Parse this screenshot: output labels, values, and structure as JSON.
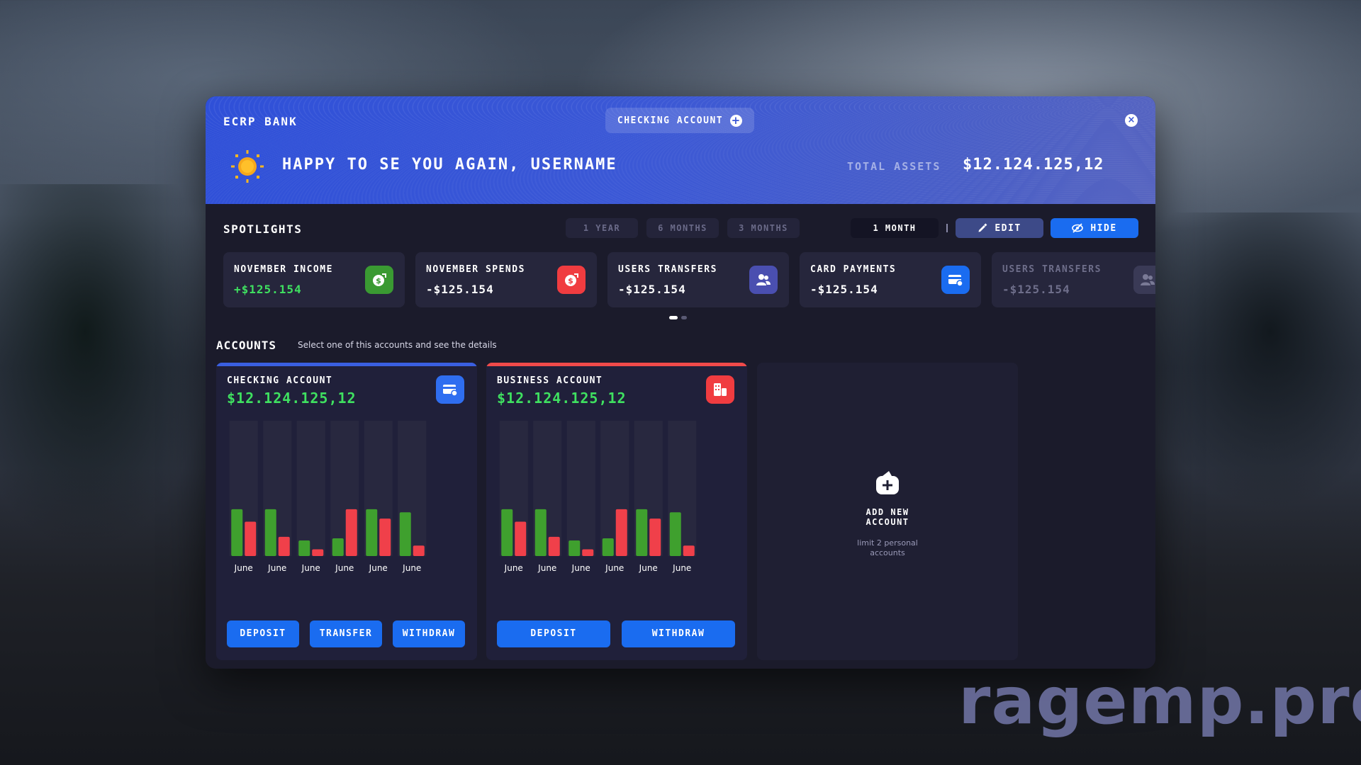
{
  "header": {
    "brand": "ECRP BANK",
    "account_selector": "CHECKING ACCOUNT",
    "greeting": "HAPPY TO SE YOU AGAIN, USERNAME",
    "total_assets_label": "TOTAL ASSETS",
    "total_assets_value": "$12.124.125,12"
  },
  "spotlights": {
    "title": "SPOTLIGHTS",
    "periods": [
      "1 YEAR",
      "6 MONTHS",
      "3 MONTHS",
      "1 MONTH"
    ],
    "active_period": "1 MONTH",
    "edit_label": "EDIT",
    "hide_label": "HIDE",
    "cards": [
      {
        "label": "NOVEMBER INCOME",
        "value": "+$125.154",
        "icon": "money-in-icon",
        "color": "#3a9a32"
      },
      {
        "label": "NOVEMBER SPENDS",
        "value": "-$125.154",
        "icon": "money-out-icon",
        "color": "#f03c40"
      },
      {
        "label": "USERS TRANSFERS",
        "value": "-$125.154",
        "icon": "users-icon",
        "color": "#4a4fb0"
      },
      {
        "label": "CARD PAYMENTS",
        "value": "-$125.154",
        "icon": "card-icon",
        "color": "#1a6cf0"
      },
      {
        "label": "USERS TRANSFERS",
        "value": "-$125.154",
        "icon": "users-icon",
        "color": "#3a3a56"
      }
    ],
    "page_count": 2,
    "current_page": 1
  },
  "accounts": {
    "title": "ACCOUNTS",
    "subtitle": "Select one of this accounts and see the details",
    "list": [
      {
        "name": "CHECKING ACCOUNT",
        "balance": "$12.124.125,12",
        "accent": "#3a5fe0",
        "icon_color": "#2f6ef0",
        "actions": [
          "DEPOSIT",
          "TRANSFER",
          "WITHDRAW"
        ]
      },
      {
        "name": "BUSINESS ACCOUNT",
        "balance": "$12.124.125,12",
        "accent": "#f04a4a",
        "icon_color": "#f03c40",
        "actions": [
          "DEPOSIT",
          "WITHDRAW"
        ]
      }
    ],
    "add_new": {
      "title_line1": "ADD NEW",
      "title_line2": "ACCOUNT",
      "subtitle_line1": "limit 2 personal",
      "subtitle_line2": "accounts"
    }
  },
  "chart_data": [
    {
      "type": "bar",
      "categories": [
        "June",
        "June",
        "June",
        "June",
        "June",
        "June"
      ],
      "series": [
        {
          "name": "income",
          "color": "#3fa02e",
          "values": [
            90,
            90,
            30,
            34,
            90,
            84
          ]
        },
        {
          "name": "spends",
          "color": "#f0404a",
          "values": [
            66,
            37,
            13,
            90,
            72,
            20
          ]
        }
      ],
      "ylim": [
        0,
        260
      ]
    },
    {
      "type": "bar",
      "categories": [
        "June",
        "June",
        "June",
        "June",
        "June",
        "June"
      ],
      "series": [
        {
          "name": "income",
          "color": "#3fa02e",
          "values": [
            90,
            90,
            30,
            34,
            90,
            84
          ]
        },
        {
          "name": "spends",
          "color": "#f0404a",
          "values": [
            66,
            37,
            13,
            90,
            72,
            20
          ]
        }
      ],
      "ylim": [
        0,
        260
      ]
    }
  ],
  "watermark": "ragemp.pro"
}
